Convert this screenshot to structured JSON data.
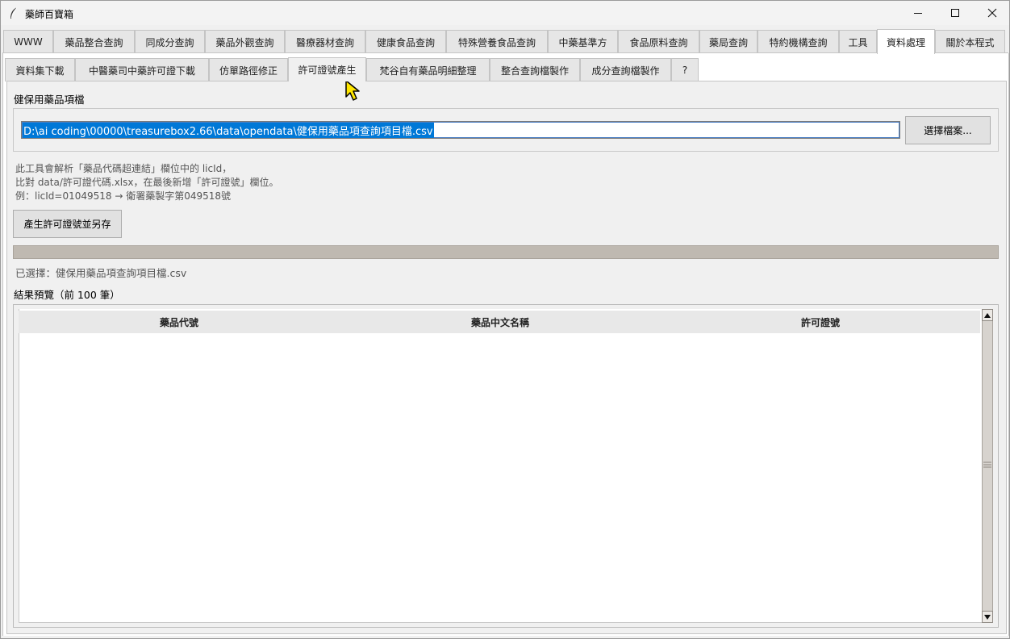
{
  "window": {
    "title": "藥師百寶箱",
    "controls": {
      "minimize": "—",
      "maximize": "☐",
      "close": "✕"
    }
  },
  "main_tabs": [
    {
      "label": "WWW"
    },
    {
      "label": "藥品整合查詢"
    },
    {
      "label": "同成分查詢"
    },
    {
      "label": "藥品外觀查詢"
    },
    {
      "label": "醫療器材查詢"
    },
    {
      "label": "健康食品查詢"
    },
    {
      "label": "特殊營養食品查詢"
    },
    {
      "label": "中藥基準方"
    },
    {
      "label": "食品原料查詢"
    },
    {
      "label": "藥局查詢"
    },
    {
      "label": "特約機構查詢"
    },
    {
      "label": "工具"
    },
    {
      "label": "資料處理",
      "active": true
    },
    {
      "label": "關於本程式"
    }
  ],
  "sub_tabs": [
    {
      "label": "資料集下載"
    },
    {
      "label": "中醫藥司中藥許可證下載"
    },
    {
      "label": "仿單路徑修正"
    },
    {
      "label": "許可證號產生",
      "active": true
    },
    {
      "label": "梵谷自有藥品明細整理"
    },
    {
      "label": "整合查詢檔製作"
    },
    {
      "label": "成分查詢檔製作"
    },
    {
      "label": "?"
    }
  ],
  "license_tool": {
    "file_section_label": "健保用藥品項檔",
    "file_path": "D:\\ai coding\\00000\\treasurebox2.66\\data\\opendata\\健保用藥品項查詢項目檔.csv",
    "browse_button": "選擇檔案...",
    "description": [
      "此工具會解析「藥品代碼超連結」欄位中的 licId，",
      "比對 data/許可證代碼.xlsx，在最後新增「許可證號」欄位。",
      "例：licId=01049518 → 衛署藥製字第049518號"
    ],
    "generate_button": "產生許可證號並另存",
    "progress": 0,
    "selected_file_text": "已選擇：健保用藥品項查詢項目檔.csv",
    "preview_label": "結果預覽（前 100 筆）",
    "columns": [
      "藥品代號",
      "藥品中文名稱",
      "許可證號"
    ],
    "rows": []
  },
  "icons": {
    "app": "feather-icon",
    "scroll_up": "scroll-up-arrow-icon",
    "scroll_down": "scroll-down-arrow-icon",
    "cursor": "mouse-pointer-icon"
  }
}
